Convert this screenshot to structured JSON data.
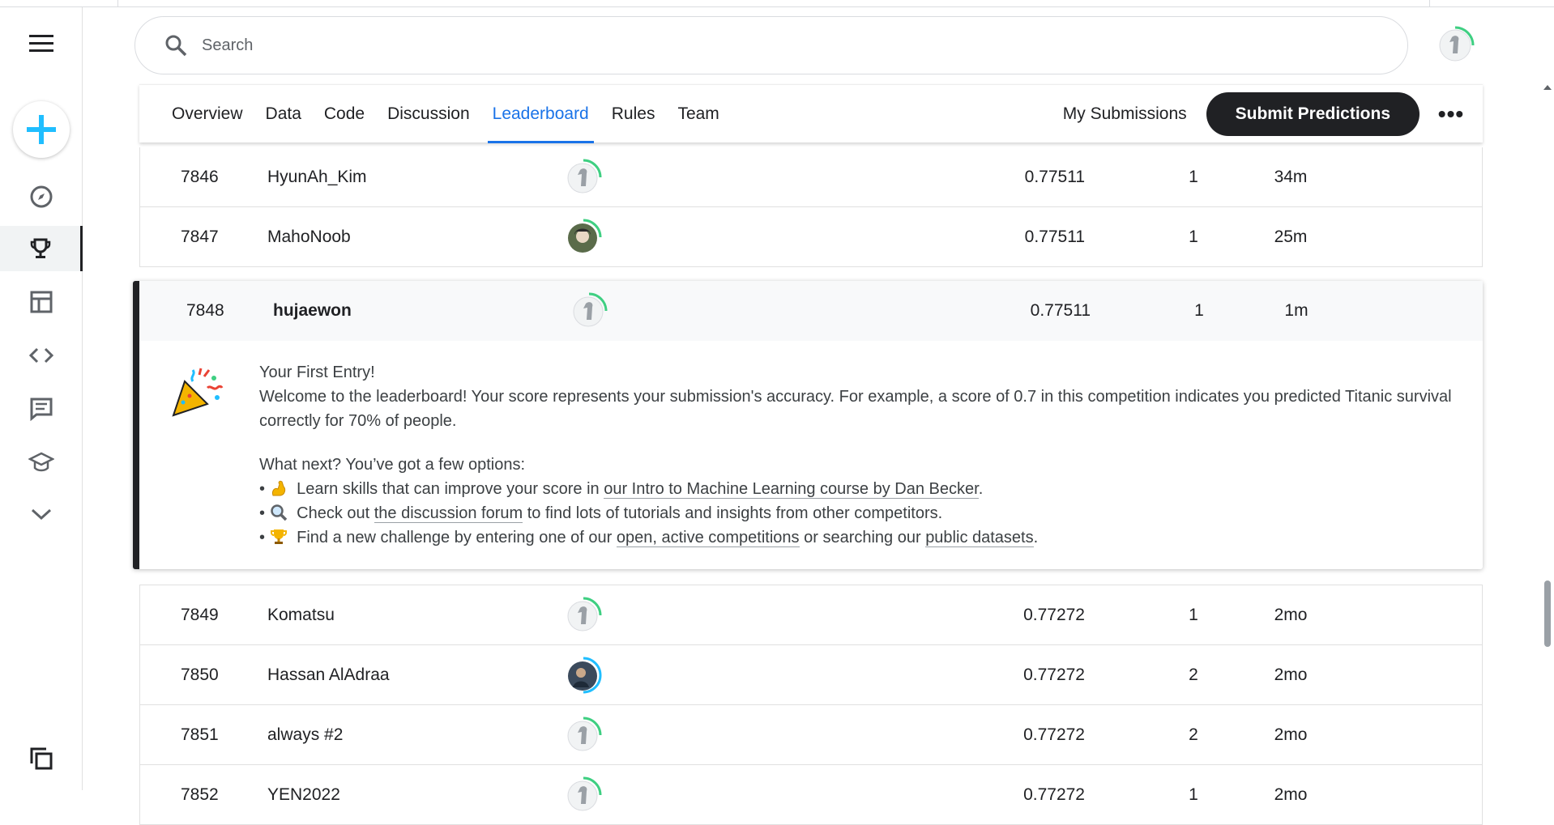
{
  "search": {
    "placeholder": "Search"
  },
  "tabs": [
    "Overview",
    "Data",
    "Code",
    "Discussion",
    "Leaderboard",
    "Rules",
    "Team"
  ],
  "active_tab": "Leaderboard",
  "header_actions": {
    "my_submissions": "My Submissions",
    "submit": "Submit Predictions",
    "more": "•••"
  },
  "rows_above": [
    {
      "rank": "7846",
      "team": "HyunAh_Kim",
      "score": "0.77511",
      "entries": "1",
      "last": "34m"
    },
    {
      "rank": "7847",
      "team": "MahoNoob",
      "score": "0.77511",
      "entries": "1",
      "last": "25m"
    }
  ],
  "my_row": {
    "rank": "7848",
    "team": "hujaewon",
    "score": "0.77511",
    "entries": "1",
    "last": "1m"
  },
  "message": {
    "title": "Your First Entry!",
    "body": "Welcome to the leaderboard! Your score represents your submission's accuracy. For example, a score of 0.7 in this competition indicates you predicted Titanic survival correctly for 70% of people.",
    "next": "What next? You’ve got a few options:",
    "b1_pre": "Learn skills that can improve your score in ",
    "b1_link": "our Intro to Machine Learning course by Dan Becker",
    "b1_post": ".",
    "b2_pre": "Check out ",
    "b2_link": "the discussion forum",
    "b2_post": " to find lots of tutorials and insights from other competitors.",
    "b3_pre": "Find a new challenge by entering one of our ",
    "b3_link1": "open, active competitions",
    "b3_mid": " or searching our ",
    "b3_link2": "public datasets",
    "b3_post": ".",
    "bullet": "•"
  },
  "rows_below": [
    {
      "rank": "7849",
      "team": "Komatsu",
      "score": "0.77272",
      "entries": "1",
      "last": "2mo"
    },
    {
      "rank": "7850",
      "team": "Hassan AlAdraa",
      "score": "0.77272",
      "entries": "2",
      "last": "2mo"
    },
    {
      "rank": "7851",
      "team": "always #2",
      "score": "0.77272",
      "entries": "2",
      "last": "2mo"
    },
    {
      "rank": "7852",
      "team": "YEN2022",
      "score": "0.77272",
      "entries": "1",
      "last": "2mo"
    }
  ],
  "colors": {
    "accent": "#1a73e8",
    "dark": "#202124",
    "progress": "#20beff",
    "avatar_ring": "#3fcf82"
  }
}
